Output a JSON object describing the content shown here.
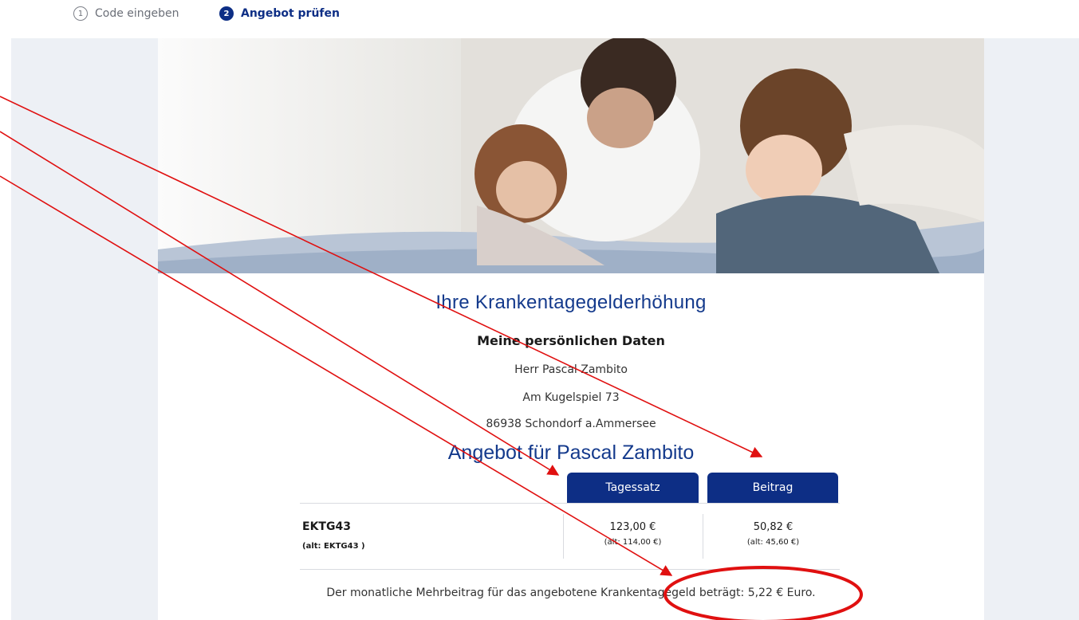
{
  "stepper": {
    "steps": [
      {
        "number": "1",
        "label": "Code eingeben"
      },
      {
        "number": "2",
        "label": "Angebot prüfen"
      }
    ]
  },
  "hero": {
    "icon": "family-photo"
  },
  "offer": {
    "title": "Ihre Krankentagegelderhöhung",
    "personal_heading": "Meine persönlichen Daten",
    "name": "Herr Pascal Zambito",
    "street": "Am Kugelspiel 73",
    "city": "86938 Schondorf a.Ammersee",
    "offer_title": "Angebot für Pascal Zambito"
  },
  "table": {
    "columns": [
      "Tagessatz",
      "Beitrag"
    ],
    "row": {
      "product": "EKTG43",
      "product_alt": "(alt: EKTG43 )",
      "tagessatz": "123,00 €",
      "tagessatz_alt": "(alt: 114,00 €)",
      "beitrag": "50,82 €",
      "beitrag_alt": "(alt: 45,60 €)"
    }
  },
  "note": "Der monatliche Mehrbeitrag für das angebotene Krankentagegeld beträgt: 5,22 € Euro.",
  "colors": {
    "primary": "#0d2e85",
    "heading": "#143a8c",
    "annotation": "#e01010"
  }
}
